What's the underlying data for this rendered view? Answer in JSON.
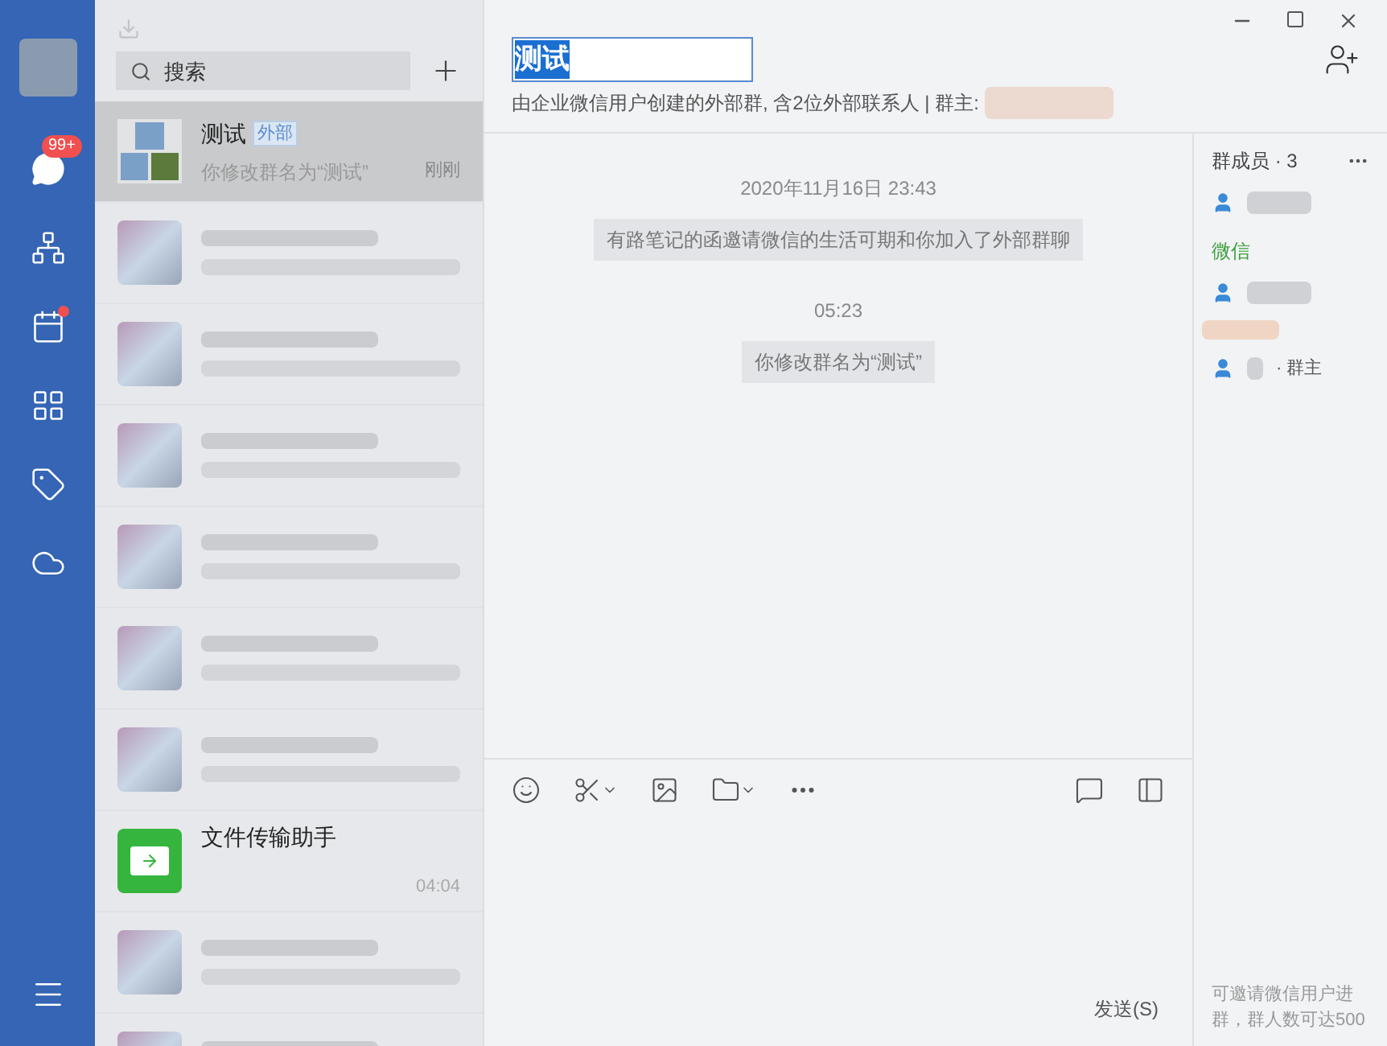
{
  "nav": [
    {
      "kind": "avatar"
    },
    {
      "kind": "chat",
      "badge": "99+"
    },
    {
      "kind": "contacts"
    },
    {
      "kind": "calendar",
      "dot": true
    },
    {
      "kind": "apps"
    },
    {
      "kind": "tag"
    },
    {
      "kind": "cloud"
    },
    {
      "kind": "menu"
    }
  ],
  "search": {
    "placeholder": "搜索"
  },
  "conversations": [
    {
      "kind": "group",
      "selected": true,
      "name": "测试",
      "tag": "外部",
      "preview": "你修改群名为“测试”",
      "time": "刚刚"
    },
    {
      "kind": "blurred",
      "selected": false
    },
    {
      "kind": "blurred",
      "selected": false
    },
    {
      "kind": "blurred",
      "selected": false
    },
    {
      "kind": "blurred",
      "selected": false
    },
    {
      "kind": "blurred",
      "selected": false
    },
    {
      "kind": "blurred",
      "selected": false
    },
    {
      "kind": "file",
      "selected": false,
      "name": "文件传输助手",
      "time": "04:04"
    },
    {
      "kind": "blurred",
      "selected": false
    },
    {
      "kind": "blurred",
      "selected": false
    }
  ],
  "chat": {
    "title": "测试",
    "subtitle": "由企业微信用户创建的外部群, 含2位外部联系人 | 群主:",
    "messages": [
      {
        "kind": "time",
        "text": "2020年11月16日 23:43"
      },
      {
        "kind": "notice",
        "text": "有路笔记的函邀请微信的生活可期和你加入了外部群聊"
      },
      {
        "kind": "time",
        "text": "05:23"
      },
      {
        "kind": "notice",
        "text": "你修改群名为“测试”"
      }
    ],
    "send": "发送(S)"
  },
  "members": {
    "title": "群成员 · 3",
    "items": [
      {
        "kind": "staff"
      },
      {
        "kind": "section",
        "text": "微信"
      },
      {
        "kind": "contact"
      },
      {
        "kind": "blurred"
      },
      {
        "kind": "contact",
        "role": "· 群主"
      }
    ],
    "footer": "可邀请微信用户进群，群人数可达500"
  }
}
